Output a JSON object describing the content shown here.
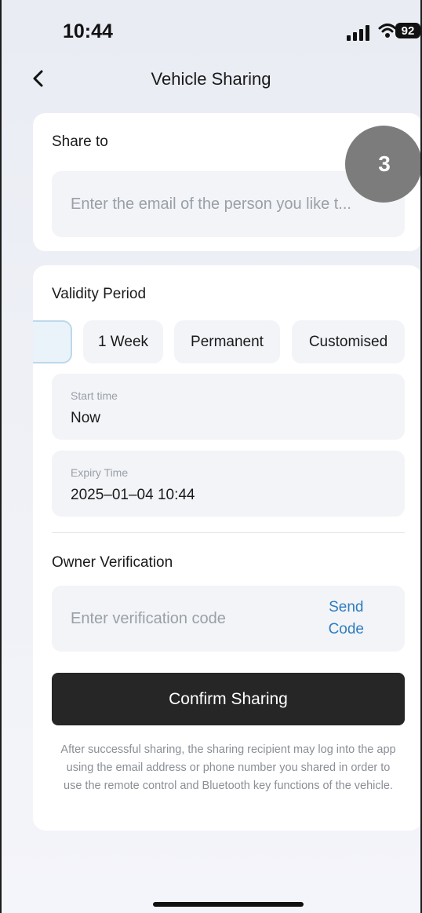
{
  "status_bar": {
    "time": "10:44",
    "battery": "92"
  },
  "nav": {
    "title": "Vehicle Sharing"
  },
  "share": {
    "label": "Share to",
    "email_placeholder": "Enter the email of the person you like t..."
  },
  "overlay": {
    "badge": "3"
  },
  "validity": {
    "label": "Validity Period",
    "options": [
      "1 Week",
      "Permanent",
      "Customised"
    ],
    "start": {
      "label": "Start time",
      "value": "Now"
    },
    "expiry": {
      "label": "Expiry Time",
      "value": "2025–01–04 10:44"
    }
  },
  "verification": {
    "label": "Owner Verification",
    "code_placeholder": "Enter verification code",
    "send_code": [
      "Send",
      "Code"
    ]
  },
  "confirm": {
    "label": "Confirm Sharing"
  },
  "note": "After successful sharing, the sharing recipient may log into the app using the email address or phone number you shared in order to use the remote control and Bluetooth key functions of the vehicle.",
  "colors": {
    "accent": "#2e7cc0",
    "button": "#262626",
    "badge": "#7c7c7c"
  }
}
